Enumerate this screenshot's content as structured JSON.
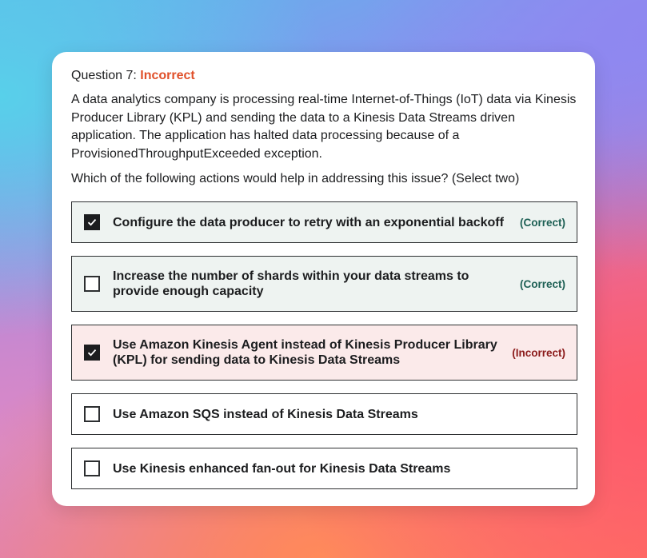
{
  "question": {
    "label": "Question 7:",
    "status": "Incorrect",
    "body": "A data analytics company is processing real-time Internet-of-Things (IoT) data via Kinesis Producer Library (KPL) and sending the data to a Kinesis Data Streams driven application. The application has halted data processing because of a ProvisionedThroughputExceeded exception.",
    "prompt": "Which of the following actions would help in addressing this issue? (Select two)"
  },
  "options": [
    {
      "text": "Configure the data producer to retry with an exponential backoff",
      "checked": true,
      "result": "(Correct)",
      "state": "correct"
    },
    {
      "text": "Increase the number of shards within your data streams to provide enough capacity",
      "checked": false,
      "result": "(Correct)",
      "state": "correct"
    },
    {
      "text": "Use Amazon Kinesis Agent instead of Kinesis Producer Library (KPL) for sending data to Kinesis Data Streams",
      "checked": true,
      "result": "(Incorrect)",
      "state": "incorrect"
    },
    {
      "text": "Use Amazon SQS instead of Kinesis Data Streams",
      "checked": false,
      "result": "",
      "state": "plain"
    },
    {
      "text": "Use Kinesis enhanced fan-out for Kinesis Data Streams",
      "checked": false,
      "result": "",
      "state": "plain"
    }
  ],
  "colors": {
    "incorrect_accent": "#e0502a",
    "correct_text": "#1e6055",
    "incorrect_text": "#8b1a1a",
    "correct_bg": "#eef3f1",
    "incorrect_bg": "#fbeaea"
  },
  "icons": {
    "check": "checkmark-icon"
  }
}
